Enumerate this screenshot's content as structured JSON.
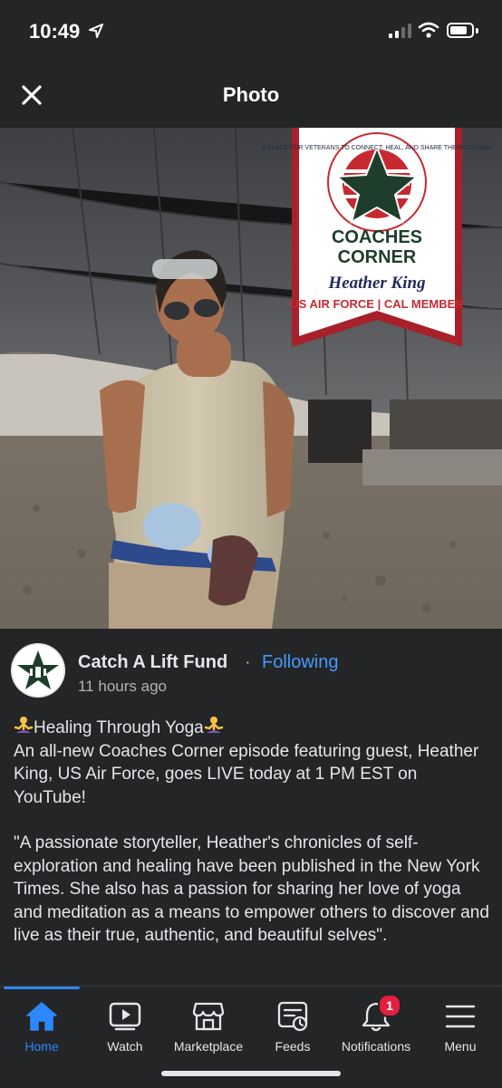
{
  "status_bar": {
    "time": "10:49"
  },
  "header": {
    "title": "Photo"
  },
  "photo": {
    "banner_tagline": "A PLACE FOR VETERANS TO CONNECT, HEAL, AND SHARE THEIR STORIES",
    "banner_title_line1": "COACHES",
    "banner_title_line2": "CORNER",
    "banner_name": "Heather King",
    "banner_affiliation": "US AIR FORCE | CAL MEMBER"
  },
  "post": {
    "page_name": "Catch A Lift Fund",
    "separator": "·",
    "follow_status": "Following",
    "time": "11 hours ago",
    "title": "Healing Through Yoga",
    "line1": "An all-new Coaches Corner episode featuring guest, Heather King, US Air Force, goes LIVE today at 1 PM EST on YouTube!",
    "quote": "\"A passionate storyteller, Heather's chronicles of self-exploration and healing have been published in the New York Times. She also has a passion for sharing her love of yoga and meditation as a means to empower others to discover and live as their true, authentic, and beautiful selves\"."
  },
  "nav": {
    "items": [
      {
        "label": "Home",
        "icon": "home-icon",
        "active": true
      },
      {
        "label": "Watch",
        "icon": "watch-icon"
      },
      {
        "label": "Marketplace",
        "icon": "marketplace-icon"
      },
      {
        "label": "Feeds",
        "icon": "feeds-icon"
      },
      {
        "label": "Notifications",
        "icon": "bell-icon",
        "badge": "1"
      },
      {
        "label": "Menu",
        "icon": "menu-icon"
      }
    ]
  },
  "colors": {
    "accent": "#2d88ff",
    "following": "#4599ff",
    "badge": "#e41e3f",
    "background": "#242526"
  }
}
